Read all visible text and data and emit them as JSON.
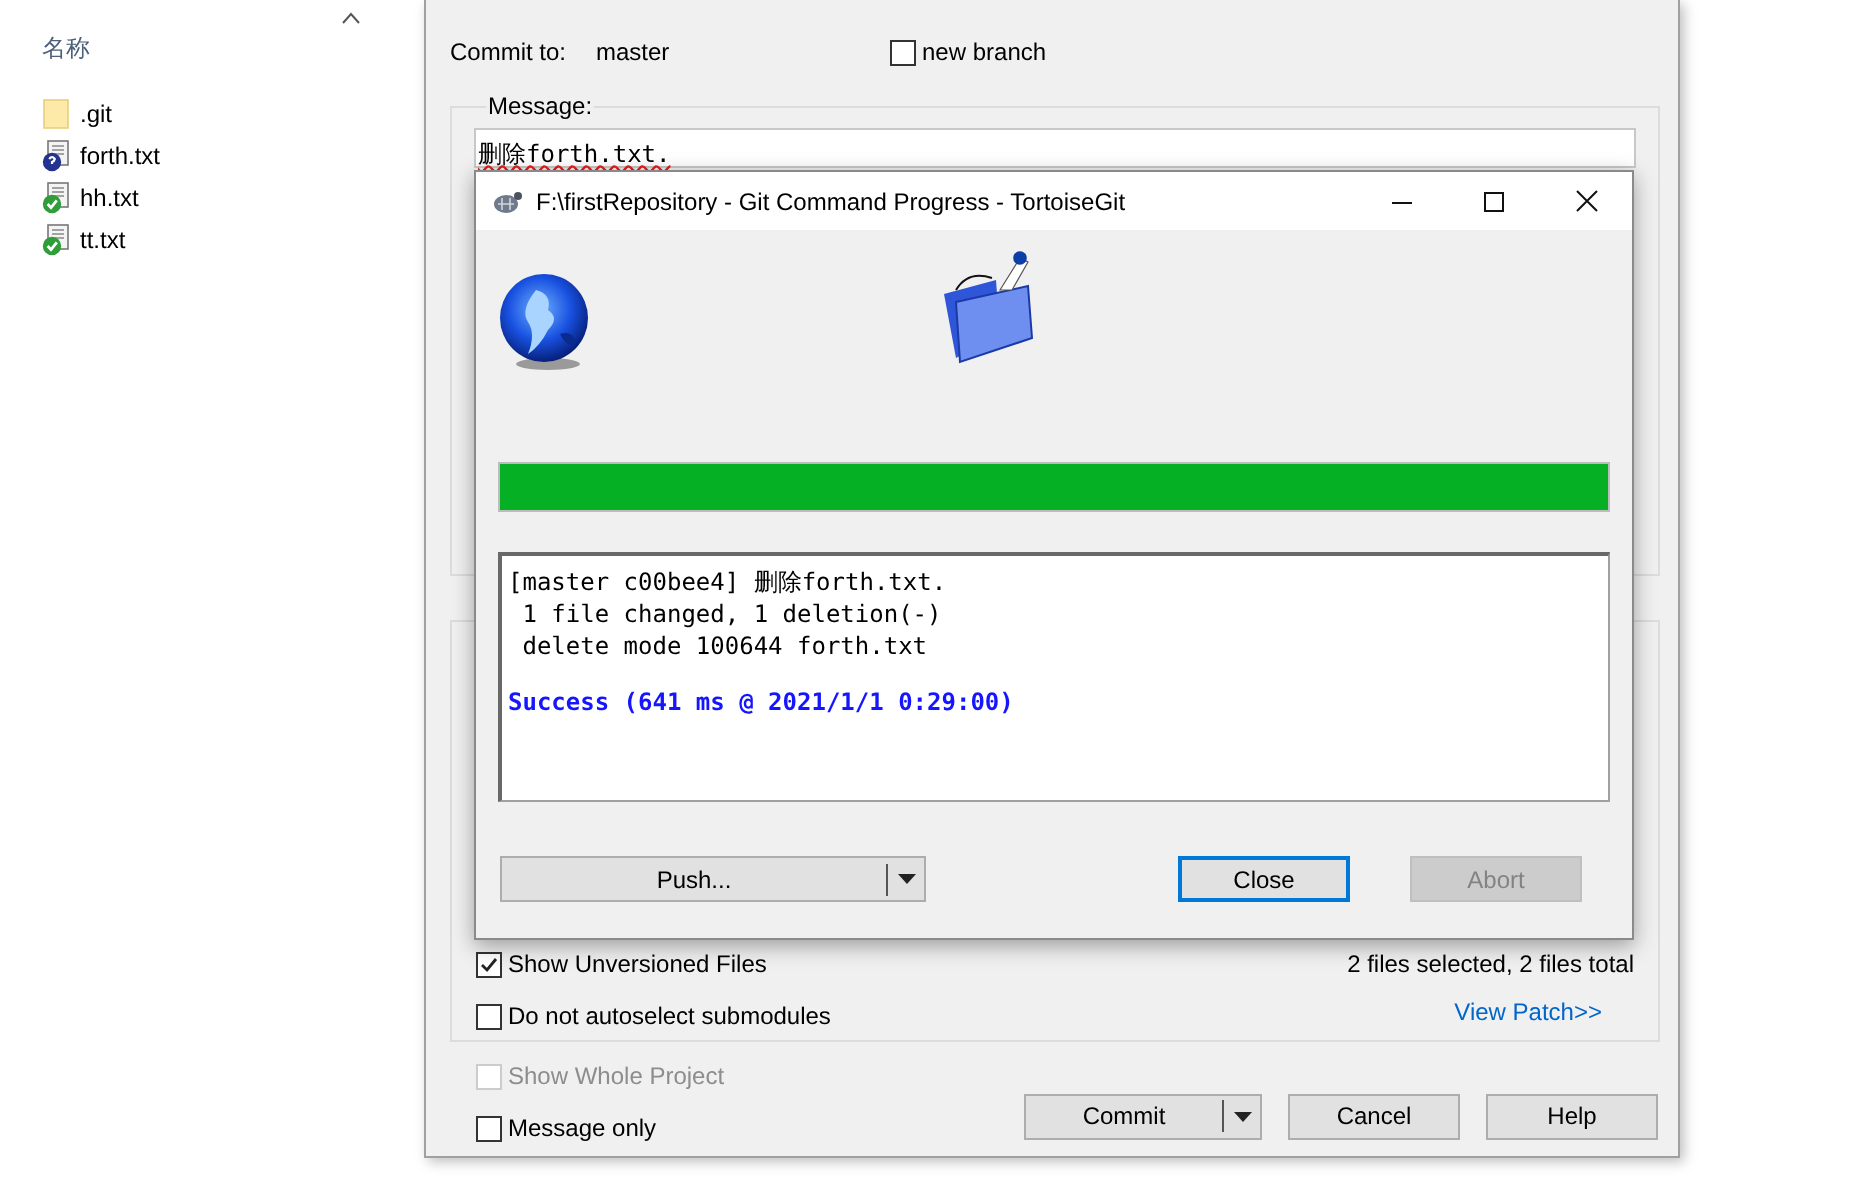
{
  "explorer": {
    "column_header": "名称",
    "files": [
      {
        "name": ".git",
        "kind": "folder"
      },
      {
        "name": "forth.txt",
        "kind": "unversioned"
      },
      {
        "name": "hh.txt",
        "kind": "versioned"
      },
      {
        "name": "tt.txt",
        "kind": "versioned"
      }
    ]
  },
  "commit_dialog": {
    "commit_to_label": "Commit to:",
    "branch": "master",
    "new_branch": {
      "label": "new branch",
      "checked": false
    },
    "message_label": "Message:",
    "message": "删除forth.txt.",
    "show_unversioned": {
      "label": "Show Unversioned Files",
      "checked": true
    },
    "no_autoselect": {
      "label": "Do not autoselect submodules",
      "checked": false
    },
    "files_status": "2 files selected, 2 files total",
    "view_patch": "View Patch>>",
    "show_whole_project": {
      "label": "Show Whole Project",
      "checked": false,
      "disabled": true
    },
    "message_only": {
      "label": "Message only",
      "checked": false
    },
    "buttons": [
      {
        "label": "Commit",
        "kind": "split"
      },
      {
        "label": "Cancel",
        "kind": "plain"
      },
      {
        "label": "Help",
        "kind": "plain"
      }
    ]
  },
  "progress_window": {
    "title": "F:\\firstRepository - Git Command Progress - TortoiseGit",
    "progress": {
      "level": 1
    },
    "log": [
      {
        "text": "[master c00bee4] 删除forth.txt.",
        "kind": "normal"
      },
      {
        "text": " 1 file changed, 1 deletion(-)",
        "kind": "normal"
      },
      {
        "text": " delete mode 100644 forth.txt",
        "kind": "normal"
      },
      {
        "text": "Success (641 ms @ 2021/1/1 0:29:00)",
        "kind": "success"
      }
    ],
    "buttons": [
      {
        "label": "Push...",
        "kind": "split",
        "disabled": false,
        "default": false
      },
      {
        "label": "Close",
        "kind": "plain",
        "disabled": false,
        "default": true
      },
      {
        "label": "Abort",
        "kind": "plain",
        "disabled": true,
        "default": false
      }
    ]
  }
}
